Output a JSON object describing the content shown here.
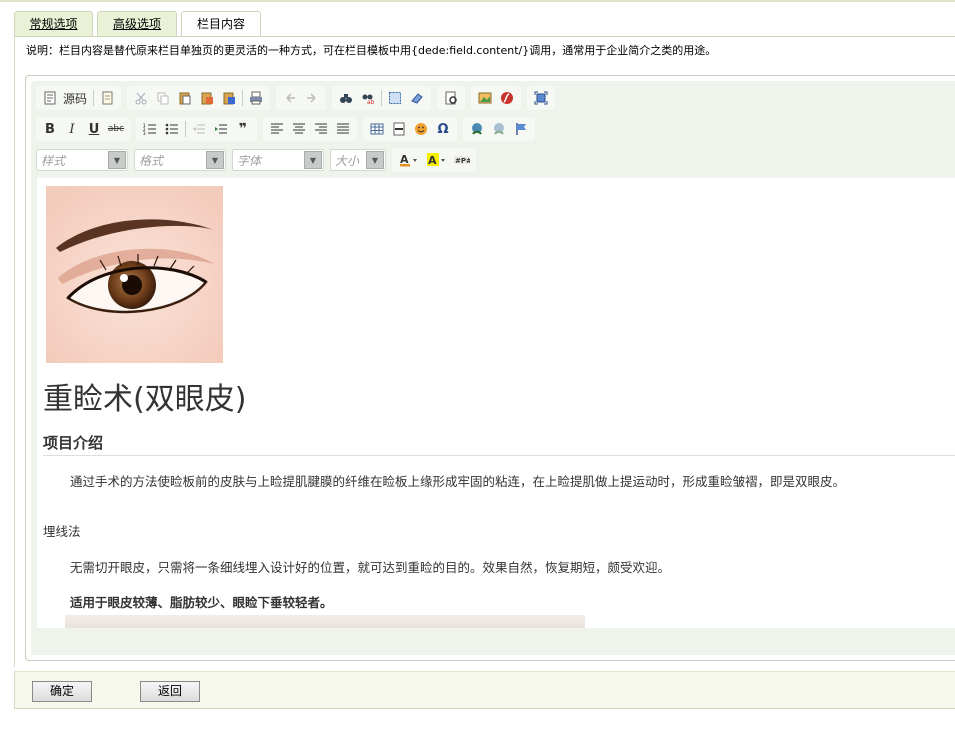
{
  "tabs": [
    {
      "label": "常规选项"
    },
    {
      "label": "高级选项"
    },
    {
      "label": "栏目内容"
    }
  ],
  "note": "说明：栏目内容是替代原来栏目单独页的更灵活的一种方式，可在栏目模板中用{dede:field.content/}调用，通常用于企业简介之类的用途。",
  "toolbar": {
    "source_label": "源码",
    "combos": [
      {
        "label": "样式"
      },
      {
        "label": "格式"
      },
      {
        "label": "字体"
      },
      {
        "label": "大小"
      }
    ]
  },
  "content": {
    "title": "重睑术(双眼皮)",
    "section_title": "项目介绍",
    "intro": "通过手术的方法使睑板前的皮肤与上睑提肌腱膜的纤维在睑板上缘形成牢固的粘连，在上睑提肌做上提运动时，形成重睑皱褶，即是双眼皮。",
    "method_title": "埋线法",
    "method_text": "无需切开眼皮，只需将一条细线埋入设计好的位置，就可达到重睑的目的。效果自然，恢复期短，颇受欢迎。",
    "method_suitable": "适用于眼皮较薄、脂肪较少、眼睑下垂较轻者。"
  },
  "buttons": {
    "confirm": "确定",
    "back": "返回"
  }
}
